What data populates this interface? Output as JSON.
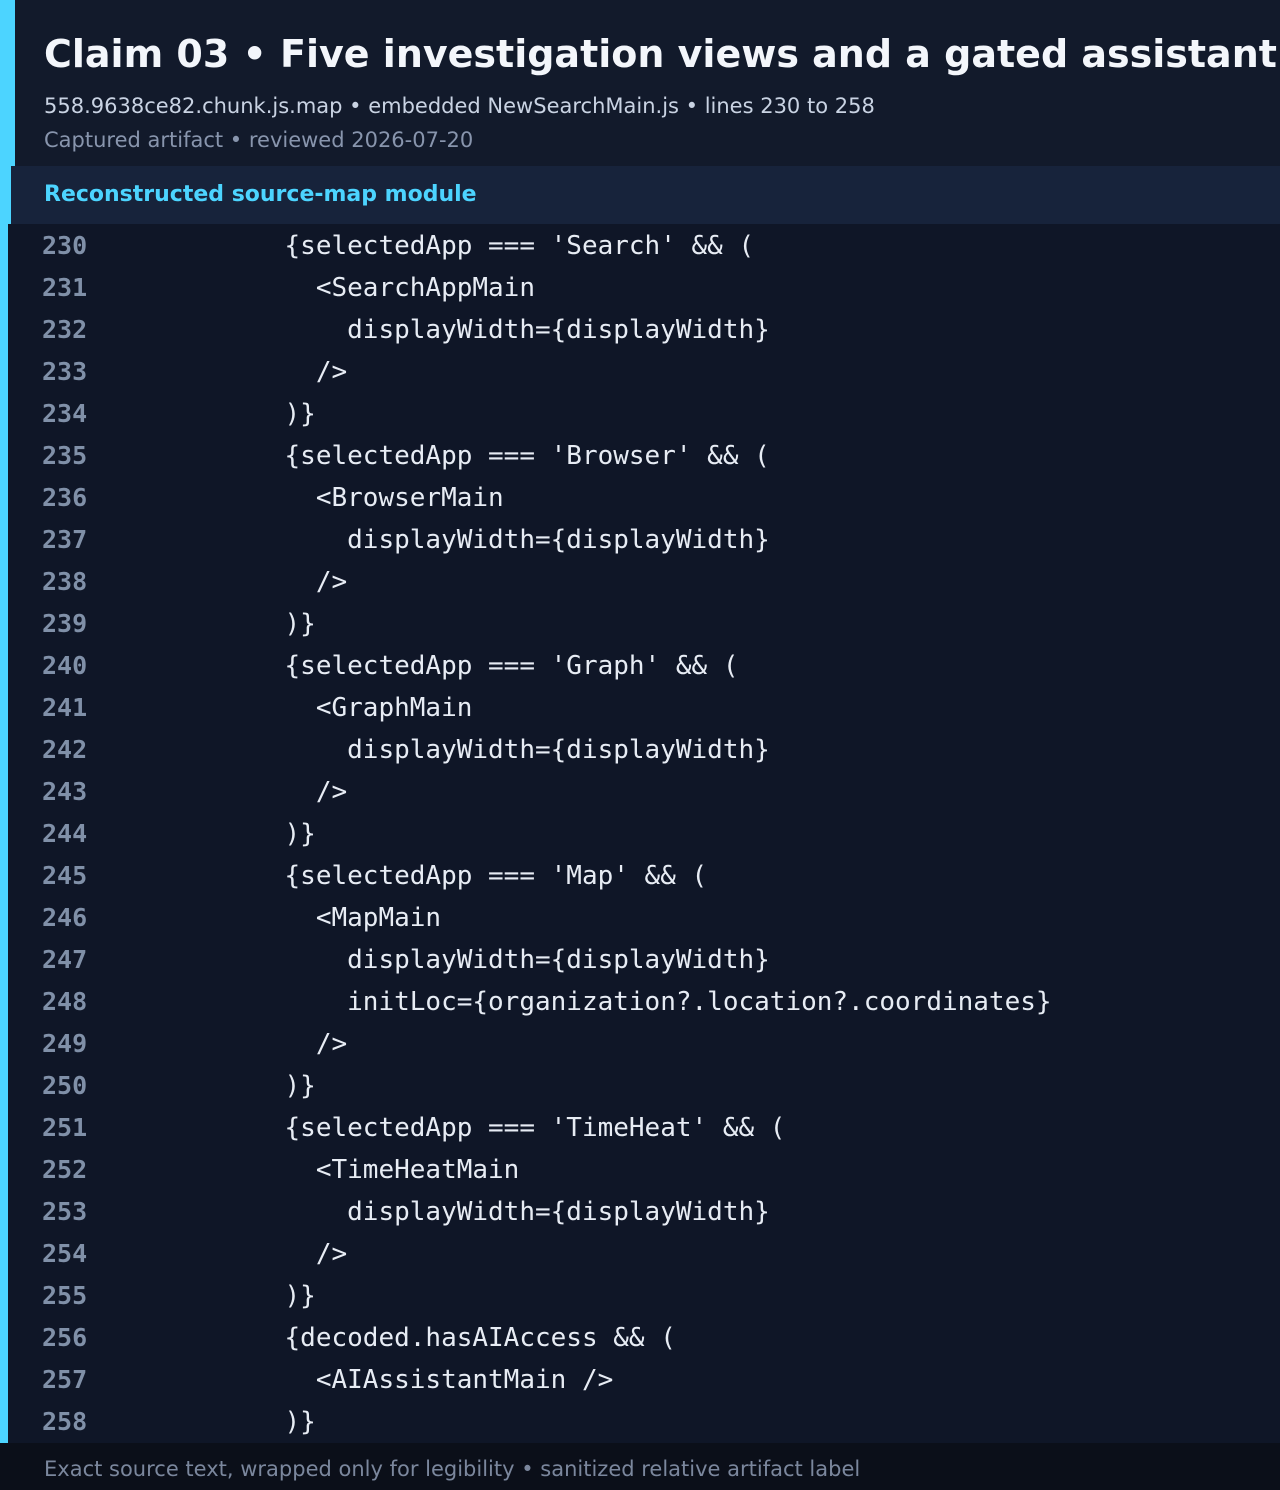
{
  "header": {
    "title": "Claim 03 • Five investigation views and a gated assistant",
    "subtitle": "558.9638ce82.chunk.js.map • embedded NewSearchMain.js • lines 230 to 258",
    "meta": "Captured artifact • reviewed 2026-07-20"
  },
  "module": {
    "label": "Reconstructed source-map module"
  },
  "code": {
    "lines": [
      {
        "num": "230",
        "text": "          {selectedApp === 'Search' && ("
      },
      {
        "num": "231",
        "text": "            <SearchAppMain"
      },
      {
        "num": "232",
        "text": "              displayWidth={displayWidth}"
      },
      {
        "num": "233",
        "text": "            />"
      },
      {
        "num": "234",
        "text": "          )}"
      },
      {
        "num": "235",
        "text": "          {selectedApp === 'Browser' && ("
      },
      {
        "num": "236",
        "text": "            <BrowserMain"
      },
      {
        "num": "237",
        "text": "              displayWidth={displayWidth}"
      },
      {
        "num": "238",
        "text": "            />"
      },
      {
        "num": "239",
        "text": "          )}"
      },
      {
        "num": "240",
        "text": "          {selectedApp === 'Graph' && ("
      },
      {
        "num": "241",
        "text": "            <GraphMain"
      },
      {
        "num": "242",
        "text": "              displayWidth={displayWidth}"
      },
      {
        "num": "243",
        "text": "            />"
      },
      {
        "num": "244",
        "text": "          )}"
      },
      {
        "num": "245",
        "text": "          {selectedApp === 'Map' && ("
      },
      {
        "num": "246",
        "text": "            <MapMain"
      },
      {
        "num": "247",
        "text": "              displayWidth={displayWidth}"
      },
      {
        "num": "248",
        "text": "              initLoc={organization?.location?.coordinates}"
      },
      {
        "num": "249",
        "text": "            />"
      },
      {
        "num": "250",
        "text": "          )}"
      },
      {
        "num": "251",
        "text": "          {selectedApp === 'TimeHeat' && ("
      },
      {
        "num": "252",
        "text": "            <TimeHeatMain"
      },
      {
        "num": "253",
        "text": "              displayWidth={displayWidth}"
      },
      {
        "num": "254",
        "text": "            />"
      },
      {
        "num": "255",
        "text": "          )}"
      },
      {
        "num": "256",
        "text": "          {decoded.hasAIAccess && ("
      },
      {
        "num": "257",
        "text": "            <AIAssistantMain />"
      },
      {
        "num": "258",
        "text": "          )}"
      }
    ]
  },
  "footer": {
    "text": "Exact source text, wrapped only for legibility • sanitized relative artifact label"
  },
  "colors": {
    "accent": "#4cd4ff",
    "background": "#0b0f19",
    "code_background": "#0f1627"
  }
}
